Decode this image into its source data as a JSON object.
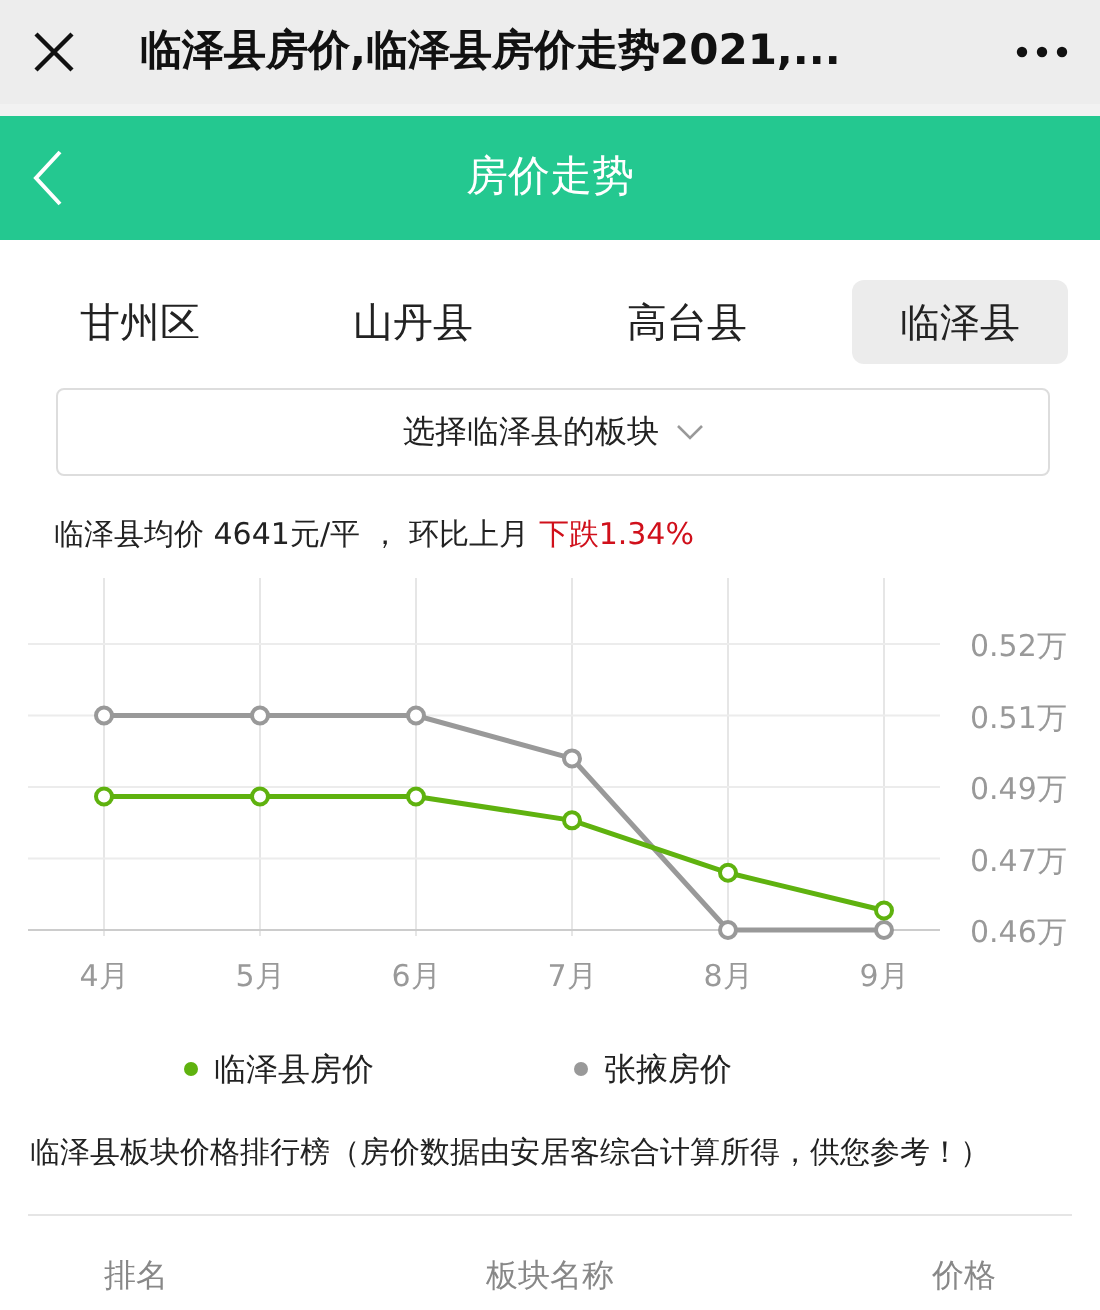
{
  "window": {
    "title": "临泽县房价,临泽县房价走势2021,..."
  },
  "header": {
    "title": "房价走势"
  },
  "tabs": [
    {
      "label": "甘州区",
      "selected": false
    },
    {
      "label": "山丹县",
      "selected": false
    },
    {
      "label": "高台县",
      "selected": false
    },
    {
      "label": "临泽县",
      "selected": true
    }
  ],
  "dropdown": {
    "label": "选择临泽县的板块"
  },
  "summary": {
    "text": "临泽县均价 4641元/平 ， 环比上月",
    "change": "下跌1.34%"
  },
  "chart_data": {
    "type": "line",
    "categories": [
      "4月",
      "5月",
      "6月",
      "7月",
      "8月",
      "9月"
    ],
    "series": [
      {
        "name": "临泽县房价",
        "color": "#5fb20f",
        "marker": "circle",
        "values": [
          0.488,
          0.488,
          0.488,
          0.483,
          0.472,
          0.4641
        ]
      },
      {
        "name": "张掖房价",
        "color": "#999999",
        "marker": "circle",
        "values": [
          0.505,
          0.505,
          0.505,
          0.496,
          0.46,
          0.46
        ]
      }
    ],
    "ylim": [
      0.46,
      0.52
    ],
    "grid": true,
    "legend": true,
    "yticks": [
      {
        "value": 0.52,
        "label": "0.52万"
      },
      {
        "value": 0.505,
        "label": "0.51万"
      },
      {
        "value": 0.49,
        "label": "0.49万"
      },
      {
        "value": 0.475,
        "label": "0.47万"
      },
      {
        "value": 0.46,
        "label": "0.46万"
      }
    ]
  },
  "ranking": {
    "title": "临泽县板块价格排行榜（房价数据由安居客综合计算所得，供您参考！）",
    "columns": [
      "排名",
      "板块名称",
      "价格"
    ]
  }
}
